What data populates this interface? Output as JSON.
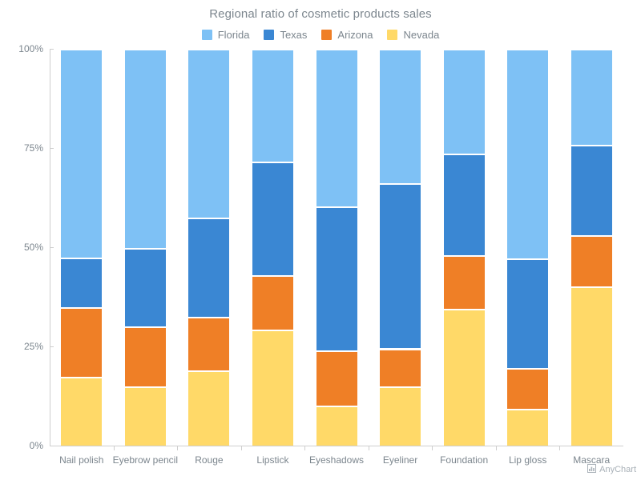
{
  "chart_data": {
    "type": "bar",
    "subtype": "stacked-percent",
    "title": "Regional ratio of cosmetic products sales",
    "xlabel": "",
    "ylabel": "",
    "ylim": [
      0,
      100
    ],
    "ytick_labels": [
      "0%",
      "25%",
      "50%",
      "75%",
      "100%"
    ],
    "ytick_values": [
      0,
      25,
      50,
      75,
      100
    ],
    "grid": false,
    "legend_position": "top",
    "stack_order_bottom_to_top": [
      "Nevada",
      "Arizona",
      "Texas",
      "Florida"
    ],
    "categories": [
      "Nail polish",
      "Eyebrow pencil",
      "Rouge",
      "Lipstick",
      "Eyeshadows",
      "Eyeliner",
      "Foundation",
      "Lip gloss",
      "Mascara"
    ],
    "series": [
      {
        "name": "Florida",
        "color": "#7ec1f5",
        "values": [
          52.7,
          50.2,
          42.5,
          28.4,
          39.7,
          33.9,
          26.4,
          52.8,
          24.2
        ]
      },
      {
        "name": "Texas",
        "color": "#3a87d3",
        "values": [
          12.4,
          19.8,
          25.0,
          28.6,
          36.3,
          41.6,
          25.7,
          27.6,
          22.8
        ]
      },
      {
        "name": "Arizona",
        "color": "#ef7f26",
        "values": [
          17.6,
          15.1,
          13.6,
          13.7,
          13.9,
          9.5,
          13.4,
          10.3,
          12.9
        ]
      },
      {
        "name": "Nevada",
        "color": "#ffd968",
        "values": [
          17.3,
          14.9,
          18.9,
          29.3,
          10.1,
          15.0,
          34.5,
          9.3,
          40.1
        ]
      }
    ],
    "cumulative_tops_percent": {
      "Nevada": [
        17.3,
        14.9,
        18.9,
        29.3,
        10.1,
        15.0,
        34.5,
        9.3,
        40.1
      ],
      "Arizona": [
        34.9,
        30.0,
        32.5,
        43.0,
        24.0,
        24.5,
        47.9,
        19.6,
        53.0
      ],
      "Texas": [
        47.3,
        49.8,
        57.5,
        71.6,
        60.3,
        66.1,
        73.6,
        47.2,
        75.8
      ],
      "Florida": [
        100,
        100,
        100,
        100,
        100,
        100,
        100,
        100,
        100
      ]
    }
  },
  "legend": {
    "items": [
      {
        "label": "Florida",
        "color": "#7ec1f5",
        "swatch": "legend-swatch-florida"
      },
      {
        "label": "Texas",
        "color": "#3a87d3",
        "swatch": "legend-swatch-texas"
      },
      {
        "label": "Arizona",
        "color": "#ef7f26",
        "swatch": "legend-swatch-arizona"
      },
      {
        "label": "Nevada",
        "color": "#ffd968",
        "swatch": "legend-swatch-nevada"
      }
    ]
  },
  "watermark": {
    "label": "AnyChart",
    "icon": "bar-chart-icon"
  },
  "theme": {
    "axis_text_color": "#7c868e",
    "axis_line_color": "#cecece",
    "title_color": "#7c868e",
    "background": "#ffffff"
  }
}
